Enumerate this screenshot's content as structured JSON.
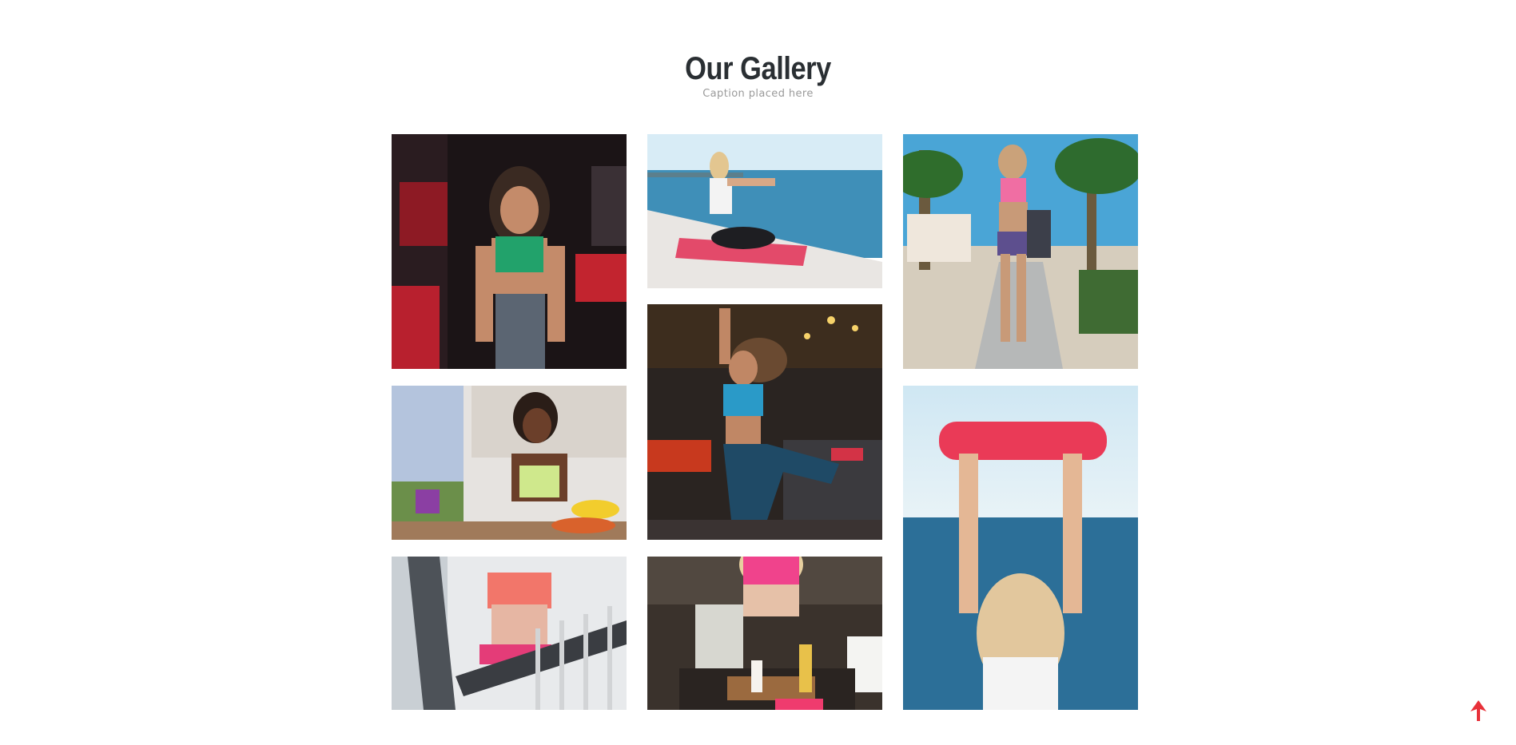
{
  "gallery": {
    "title": "Our Gallery",
    "caption": "Caption placed here",
    "items": [
      {
        "subject": "woman in green sports bra in gym"
      },
      {
        "subject": "woman doing yoga on pink mat by the sea"
      },
      {
        "subject": "woman walking on promenade with palm trees"
      },
      {
        "subject": "woman in kitchen with fruit"
      },
      {
        "subject": "woman jumping in dance studio"
      },
      {
        "subject": "woman holding red yoga mat above head by the sea"
      },
      {
        "subject": "woman in coral sports bra on balcony"
      },
      {
        "subject": "woman making smoothie in kitchen"
      }
    ]
  },
  "back_to_top": {
    "icon": "arrow-up-icon",
    "color": "#e8313a"
  }
}
